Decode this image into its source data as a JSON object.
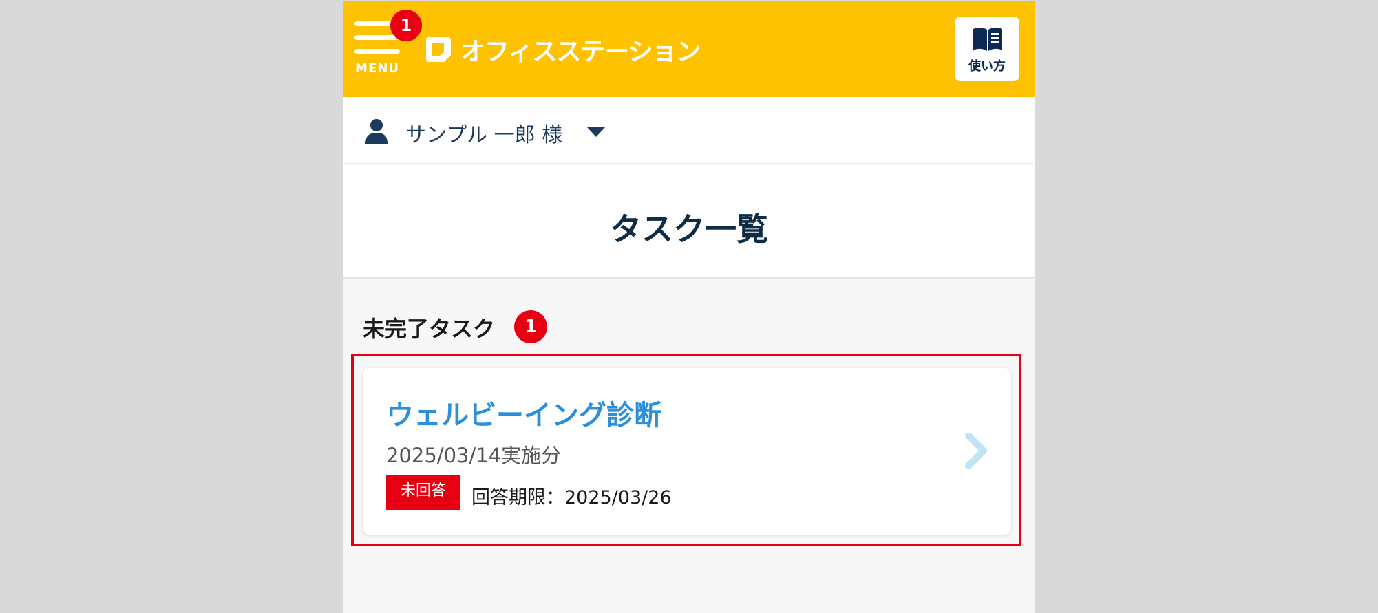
{
  "header": {
    "menu_label": "MENU",
    "menu_badge": "1",
    "logo_text": "オフィスステーション",
    "howto_label": "使い方"
  },
  "user": {
    "name": "サンプル 一郎 様"
  },
  "page": {
    "title": "タスク一覧"
  },
  "incomplete_section": {
    "heading": "未完了タスク",
    "count": "1",
    "tasks": [
      {
        "title": "ウェルビーイング診断",
        "date": "2025/03/14実施分",
        "status": "未回答",
        "deadline": "回答期限：2025/03/26"
      }
    ]
  },
  "colors": {
    "header_bg": "#ffc200",
    "badge_red": "#e60012",
    "task_title_blue": "#2b8fdb",
    "navy": "#0d2a55",
    "chevron_light_blue": "#bfe3f7"
  },
  "icons": {
    "menu": "hamburger-icon",
    "logo": "office-station-logo-icon",
    "howto": "book-icon",
    "user": "user-icon",
    "dropdown": "caret-down-icon",
    "task_arrow": "chevron-right-icon"
  }
}
